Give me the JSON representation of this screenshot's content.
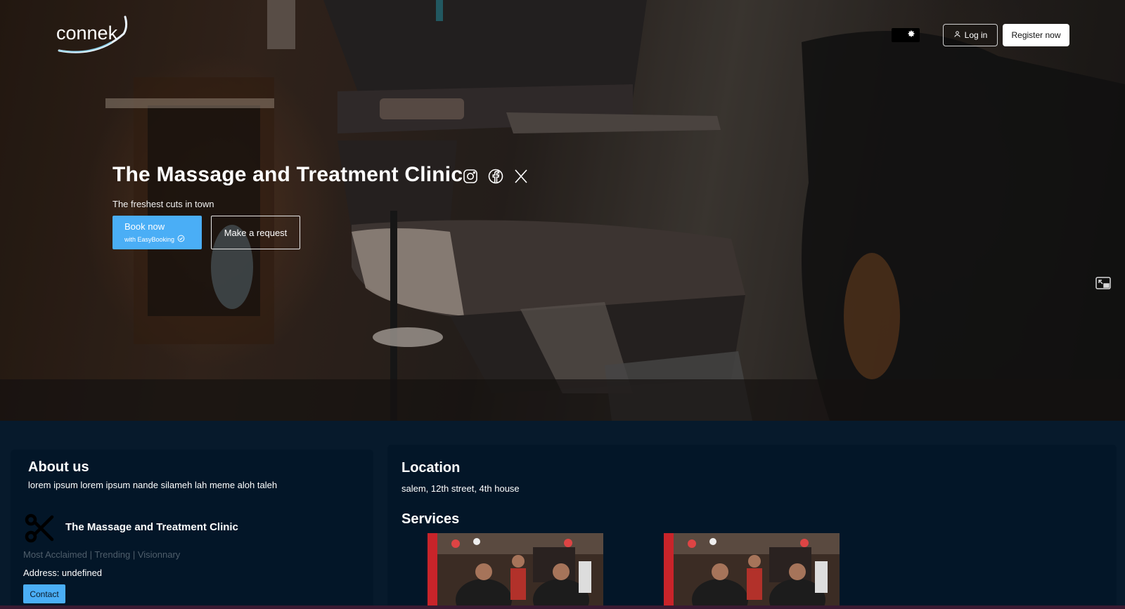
{
  "header": {
    "logo_text": "connek",
    "theme_toggle_icon": "gear-icon",
    "login_label": "Log in",
    "register_label": "Register now"
  },
  "hero": {
    "title": "The Massage and Treatment Clinic",
    "tagline": "The freshest cuts in town",
    "socials": [
      "instagram-icon",
      "facebook-icon",
      "x-icon"
    ],
    "book_label": "Book now",
    "book_sub_label": "with EasyBooking",
    "request_label": "Make a request"
  },
  "about": {
    "title": "About us",
    "text": "lorem ipsum lorem ipsum nande silameh lah meme aloh taleh",
    "business_name": "The Massage and Treatment Clinic",
    "tags": "Most Acclaimed | Trending | Visionnary",
    "address": "Address: undefined",
    "contact_label": "Contact"
  },
  "location": {
    "title": "Location",
    "address": "salem, 12th street, 4th house"
  },
  "services": {
    "title": "Services",
    "images": [
      "barbershop-photo",
      "barbershop-photo"
    ]
  },
  "colors": {
    "accent": "#4aaef6",
    "page_bg": "#071a2c",
    "card_bg": "#031628"
  }
}
